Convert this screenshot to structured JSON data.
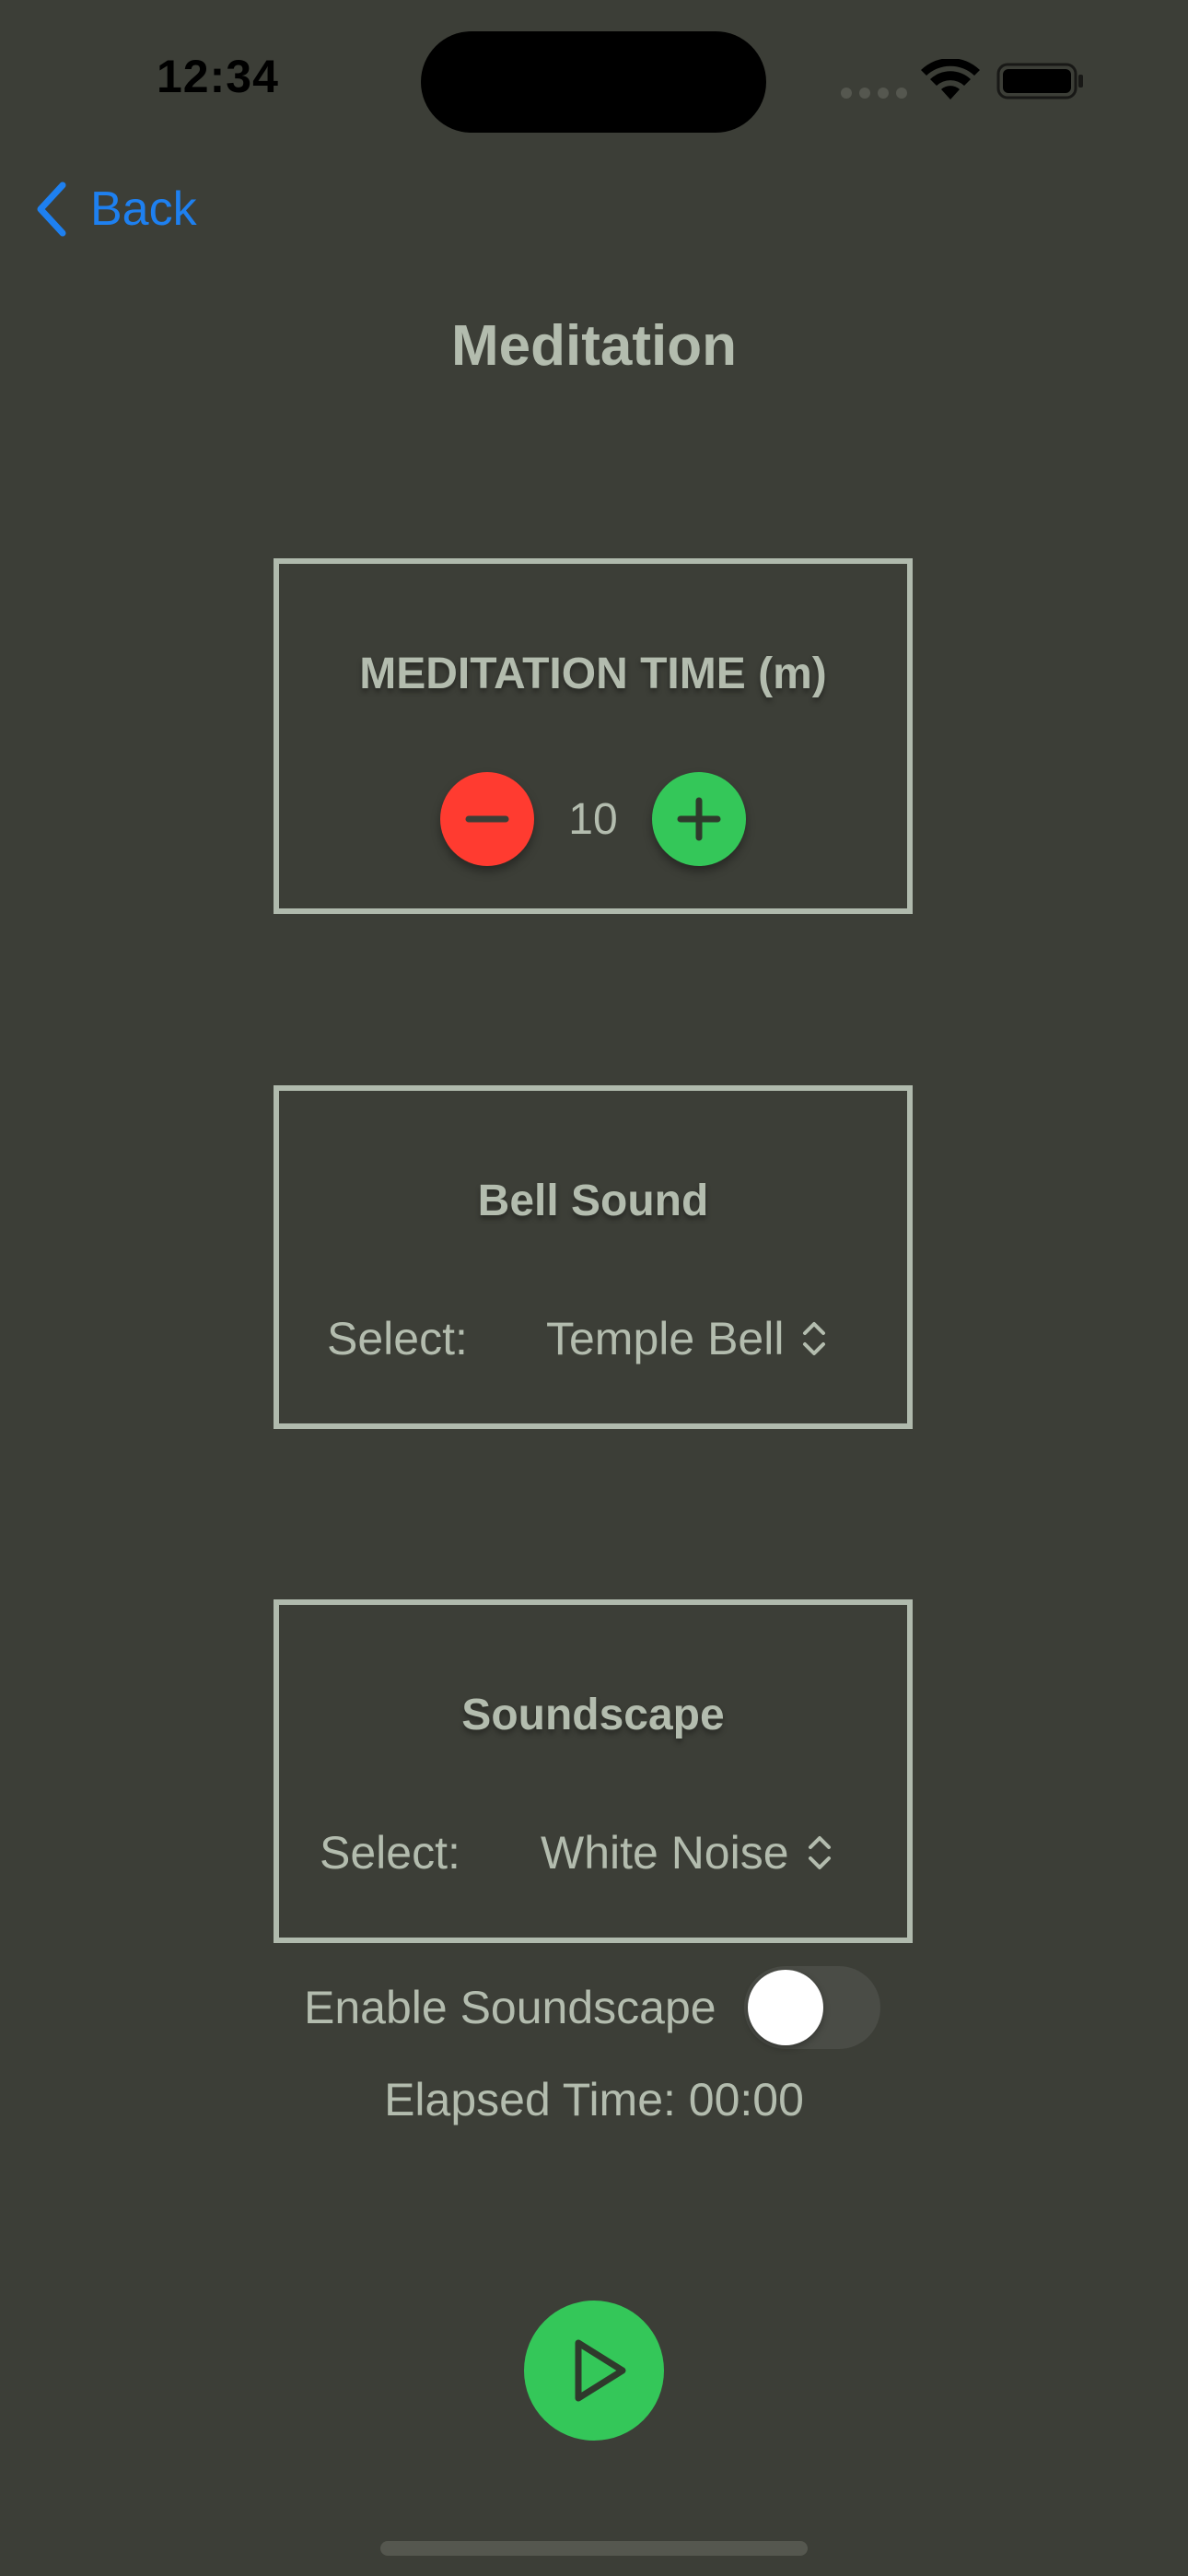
{
  "status_bar": {
    "time": "12:34"
  },
  "nav": {
    "back_label": "Back"
  },
  "page": {
    "title": "Meditation"
  },
  "meditation_time": {
    "title": "MEDITATION TIME (m)",
    "value": "10"
  },
  "bell_sound": {
    "title": "Bell Sound",
    "select_label": "Select:",
    "selected": "Temple Bell"
  },
  "soundscape": {
    "title": "Soundscape",
    "select_label": "Select:",
    "selected": "White Noise",
    "enable_label": "Enable Soundscape",
    "enabled": false
  },
  "elapsed": {
    "text": "Elapsed Time: 00:00"
  },
  "colors": {
    "background": "#3c3e37",
    "text": "#b3bcae",
    "accent_blue": "#1e80f0",
    "minus_red": "#ff3b30",
    "plus_green": "#34c759"
  },
  "icons": {
    "back": "chevron-left-icon",
    "minus": "minus-icon",
    "plus": "plus-icon",
    "picker": "chevron-up-down-icon",
    "play": "play-icon",
    "wifi": "wifi-icon",
    "battery": "battery-icon"
  }
}
